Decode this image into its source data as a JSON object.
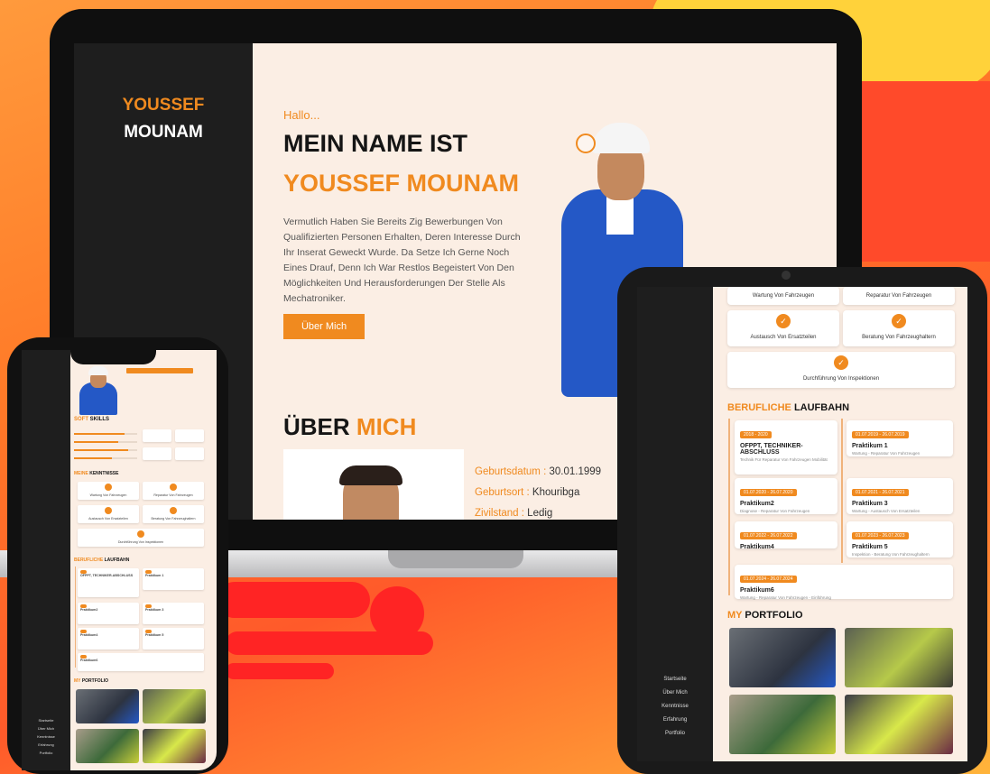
{
  "brand": {
    "first": "YOUSSEF",
    "last": "MOUNAM"
  },
  "hero": {
    "greeting": "Hallo...",
    "line1": "MEIN NAME IST",
    "line2": "YOUSSEF MOUNAM",
    "intro": "Vermutlich Haben Sie Bereits Zig Bewerbungen Von Qualifizierten Personen Erhalten, Deren Interesse Durch Ihr Inserat Geweckt Wurde. Da Setze Ich Gerne Noch Eines Drauf, Denn Ich War Restlos Begeistert Von Den Möglichkeiten Und Herausforderungen Der Stelle Als Mechatroniker.",
    "button": "Über Mich"
  },
  "about": {
    "title_a": "ÜBER",
    "title_b": "MICH",
    "facts": [
      {
        "label": "Geburtsdatum :",
        "value": "30.01.1999"
      },
      {
        "label": "Geburtsort :",
        "value": "Khouribga"
      },
      {
        "label": "Zivilstand :",
        "value": "Ledig"
      }
    ]
  },
  "services": {
    "items": [
      "Wartung Von Fahrzeugen",
      "Reparatur Von Fahrzeugen",
      "Austausch Von Ersatzteilen",
      "Beratung Von Fahrzeughaltern",
      "Durchführung Von Inspektionen"
    ]
  },
  "career": {
    "title_a": "BERUFLICHE",
    "title_b": "LAUFBAHN",
    "entries": [
      {
        "title": "OFPPT, TECHNIKER-ABSCHLUSS",
        "tag": "2018 - 2020",
        "desc": "Technik Für Reparatur Von Fahrzeugen Mobilität"
      },
      {
        "title": "Praktikum 1",
        "tag": "01.07.2019 - 26.07.2019",
        "desc": "Wartung - Reparatur Von Fahrzeugen"
      },
      {
        "title": "Praktikum2",
        "tag": "01.07.2020 - 26.07.2020",
        "desc": "Diagnose - Reparatur Von Fahrzeugen"
      },
      {
        "title": "Praktikum 3",
        "tag": "01.07.2021 - 26.07.2021",
        "desc": "Wartung - Austausch Von Ersatzteilen"
      },
      {
        "title": "Praktikum4",
        "tag": "01.07.2022 - 26.07.2022",
        "desc": ""
      },
      {
        "title": "Praktikum 5",
        "tag": "01.07.2023 - 26.07.2023",
        "desc": "Inspektion - Beratung Von Fahrzeughaltern"
      },
      {
        "title": "Praktikum6",
        "tag": "01.07.2024 - 26.07.2024",
        "desc": "Wartung - Reparatur Von Fahrzeugen - Einführung"
      }
    ]
  },
  "portfolio": {
    "title_a": "MY",
    "title_b": "PORTFOLIO"
  },
  "skills": {
    "title_a": "SOFT",
    "title_b": "SKILLS"
  },
  "strengths": {
    "title_a": "MEINE",
    "title_b": "KENNTNISSE"
  },
  "nav": [
    "Startseite",
    "Über Mich",
    "Kenntnisse",
    "Erfahrung",
    "Portfolio"
  ],
  "colors": {
    "accent": "#f08a1f",
    "sidebar": "#1e1e1e",
    "background": "#fbeee4",
    "jacket": "#2458c6"
  }
}
